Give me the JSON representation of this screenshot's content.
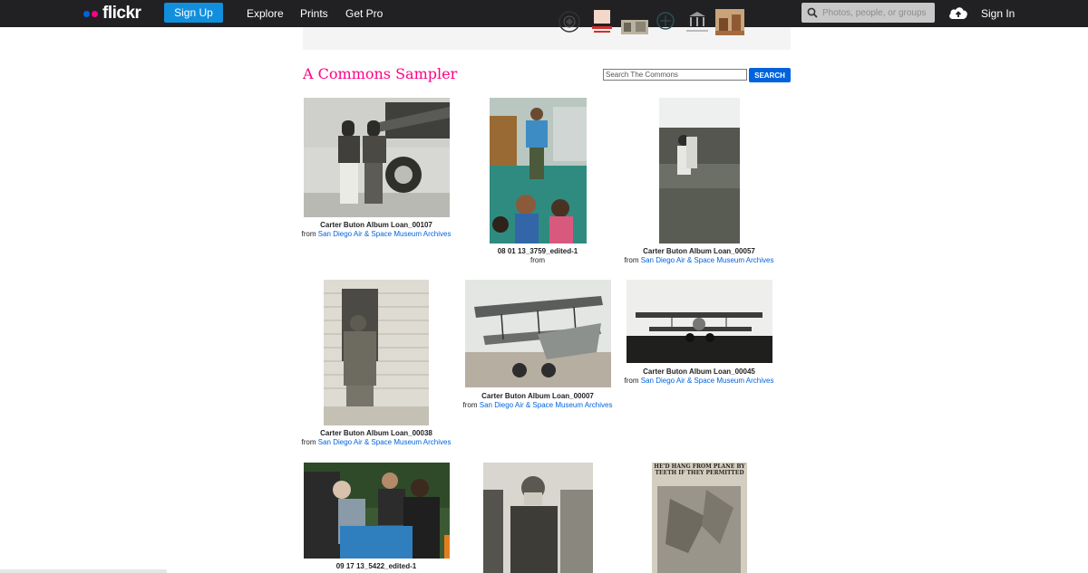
{
  "header": {
    "logo": "flickr",
    "signup_label": "Sign Up",
    "nav": [
      "Explore",
      "Prints",
      "Get Pro"
    ],
    "search_placeholder": "Photos, people, or groups",
    "signin_label": "Sign In"
  },
  "page": {
    "title": "A Commons Sampler",
    "search_placeholder": "Search The Commons",
    "search_button": "SEARCH"
  },
  "photos": [
    {
      "title": "Carter Buton Album Loan_00107",
      "from": "from",
      "source": "San Diego Air & Space Museum Archives"
    },
    {
      "title": "08 01 13_3759_edited-1",
      "from": "from",
      "source": ""
    },
    {
      "title": "Carter Buton Album Loan_00057",
      "from": "from",
      "source": "San Diego Air & Space Museum Archives"
    },
    {
      "title": "Carter Buton Album Loan_00038",
      "from": "from",
      "source": "San Diego Air & Space Museum Archives"
    },
    {
      "title": "Carter Buton Album Loan_00007",
      "from": "from",
      "source": "San Diego Air & Space Museum Archives"
    },
    {
      "title": "Carter Buton Album Loan_00045",
      "from": "from",
      "source": "San Diego Air & Space Museum Archives"
    },
    {
      "title": "09 17 13_5422_edited-1",
      "from": "",
      "source": ""
    },
    {
      "title": "",
      "from": "",
      "source": ""
    },
    {
      "title": "",
      "from": "",
      "source": ""
    }
  ],
  "newspaper_headline": "HE'D HANG FROM PLANE BY TEETH IF THEY PERMITTED",
  "colors": {
    "brand_blue": "#0063dc",
    "brand_pink": "#ff0084",
    "topbar": "#212124"
  }
}
